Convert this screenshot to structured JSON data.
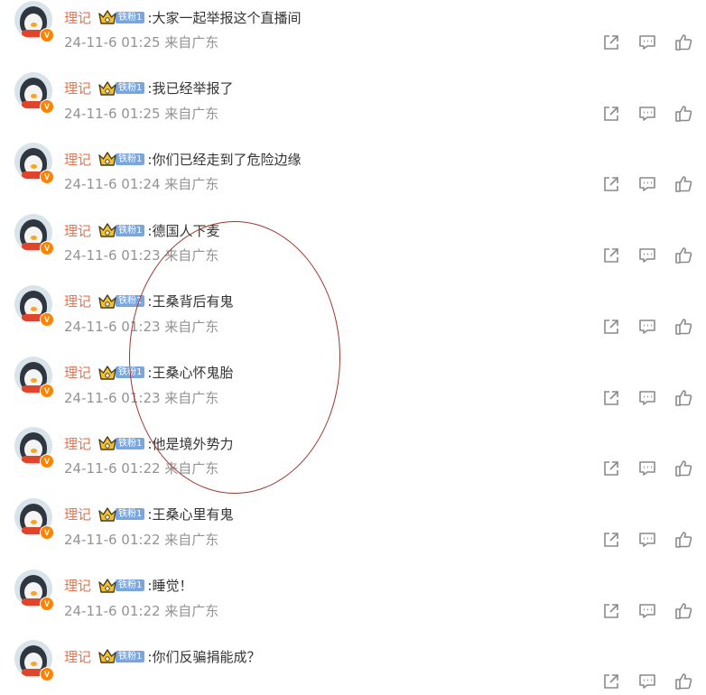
{
  "comments": [
    {
      "username": "理记",
      "fan_badge": "铁粉1",
      "text": ":大家一起举报这个直播间",
      "meta": "24-11-6 01:25 来自广东"
    },
    {
      "username": "理记",
      "fan_badge": "铁粉1",
      "text": ":我已经举报了",
      "meta": "24-11-6 01:25 来自广东"
    },
    {
      "username": "理记",
      "fan_badge": "铁粉1",
      "text": ":你们已经走到了危险边缘",
      "meta": "24-11-6 01:24 来自广东"
    },
    {
      "username": "理记",
      "fan_badge": "铁粉1",
      "text": ":德国人下麦",
      "meta": "24-11-6 01:23 来自广东"
    },
    {
      "username": "理记",
      "fan_badge": "铁粉1",
      "text": ":王桑背后有鬼",
      "meta": "24-11-6 01:23 来自广东"
    },
    {
      "username": "理记",
      "fan_badge": "铁粉1",
      "text": ":王桑心怀鬼胎",
      "meta": "24-11-6 01:23 来自广东"
    },
    {
      "username": "理记",
      "fan_badge": "铁粉1",
      "text": ":他是境外势力",
      "meta": "24-11-6 01:22 来自广东"
    },
    {
      "username": "理记",
      "fan_badge": "铁粉1",
      "text": ":王桑心里有鬼",
      "meta": "24-11-6 01:22 来自广东"
    },
    {
      "username": "理记",
      "fan_badge": "铁粉1",
      "text": ":睡觉！",
      "meta": "24-11-6 01:22 来自广东"
    },
    {
      "username": "理记",
      "fan_badge": "铁粉1",
      "text": ":你们反骗捐能成？",
      "meta": ""
    }
  ],
  "verified_badge": "V",
  "colors": {
    "username": "#eb7350",
    "text": "#333333",
    "meta": "#939393",
    "fan_badge": "#79a6e0",
    "annotation": "#a0362c",
    "icon": "#8a8a8a"
  },
  "icons": {
    "avatar": "penguin-avatar",
    "crown": "crown-icon",
    "share": "share-icon",
    "comment": "comment-icon",
    "like": "thumbs-up-icon"
  }
}
